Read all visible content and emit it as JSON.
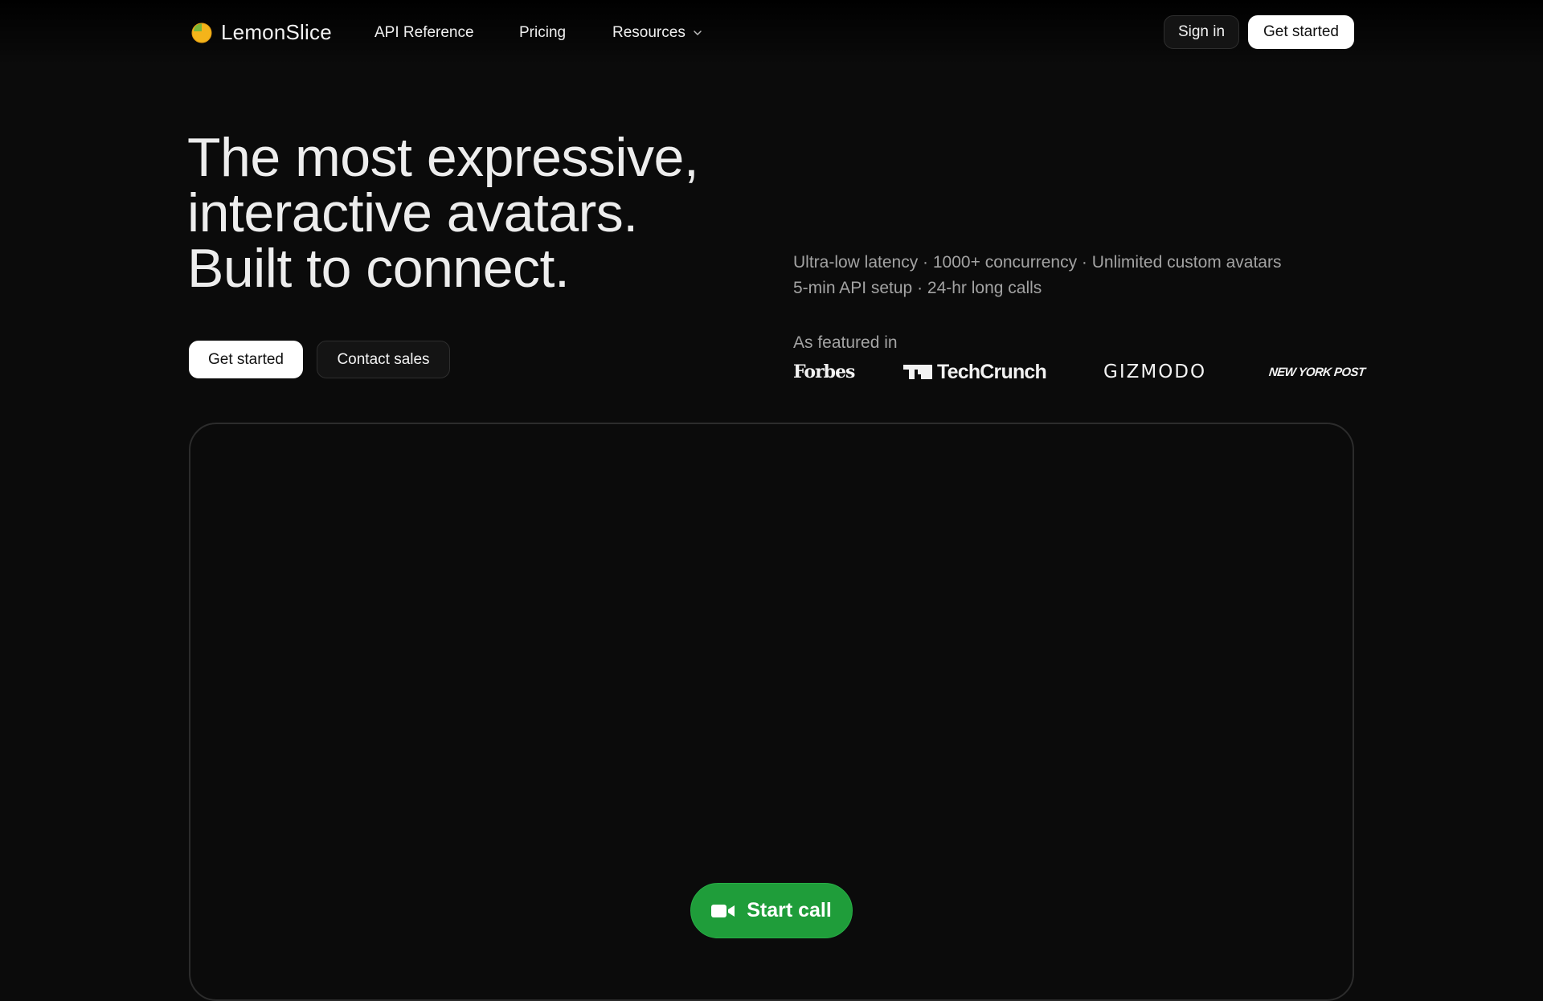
{
  "header": {
    "brand": "LemonSlice",
    "logo_icon": "lemon-icon",
    "nav": {
      "api_reference": "API Reference",
      "pricing": "Pricing",
      "resources": "Resources"
    },
    "sign_in": "Sign in",
    "get_started": "Get started"
  },
  "hero": {
    "title_lines": [
      "The most expressive,",
      "interactive avatars.",
      "Built to connect."
    ],
    "get_started": "Get started",
    "contact_sales": "Contact sales",
    "features": [
      "Ultra-low latency · 1000+ concurrency · Unlimited custom avatars",
      "5-min API setup · 24-hr long calls"
    ],
    "featured_label": "As featured in",
    "press": {
      "forbes": "Forbes",
      "techcrunch": "TechCrunch",
      "gizmodo": "GIZMODO",
      "nypost": "NEW YORK POST"
    }
  },
  "video": {
    "start_call": "Start call",
    "call_icon": "video-camera-icon"
  },
  "colors": {
    "background": "#0b0b0b",
    "call_button": "#1f9d3a",
    "muted_text": "#a3a3a3"
  }
}
